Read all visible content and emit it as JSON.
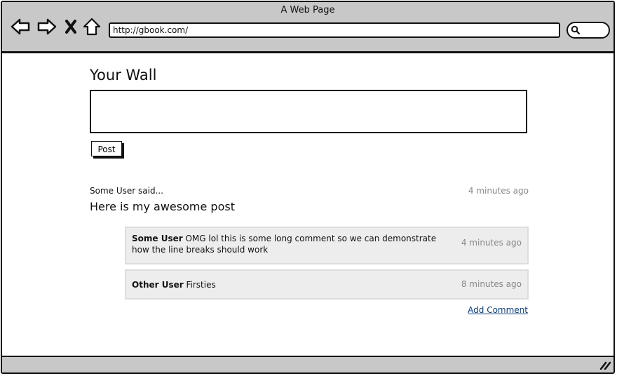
{
  "window": {
    "title": "A Web Page"
  },
  "browser": {
    "url": "http://gbook.com/",
    "icons": [
      "back-arrow-icon",
      "forward-arrow-icon",
      "stop-icon",
      "home-icon",
      "search-icon",
      "resize-grip-icon"
    ]
  },
  "wall": {
    "title": "Your Wall",
    "post_input_value": "",
    "post_button_label": "Post"
  },
  "post": {
    "author_line": "Some User said...",
    "time": "4 minutes ago",
    "body": "Here is my awesome post"
  },
  "comments": [
    {
      "author": "Some User",
      "text": "OMG lol this is some long comment so we can demonstrate how the line breaks should work",
      "time": "4 minutes ago"
    },
    {
      "author": "Other User",
      "text": "Firsties",
      "time": "8 minutes ago"
    }
  ],
  "add_comment_label": "Add Comment",
  "colors": {
    "chrome": "#c8c8c8",
    "comment_bg": "#ededed",
    "link": "#0a3d7a",
    "muted": "#888888"
  }
}
